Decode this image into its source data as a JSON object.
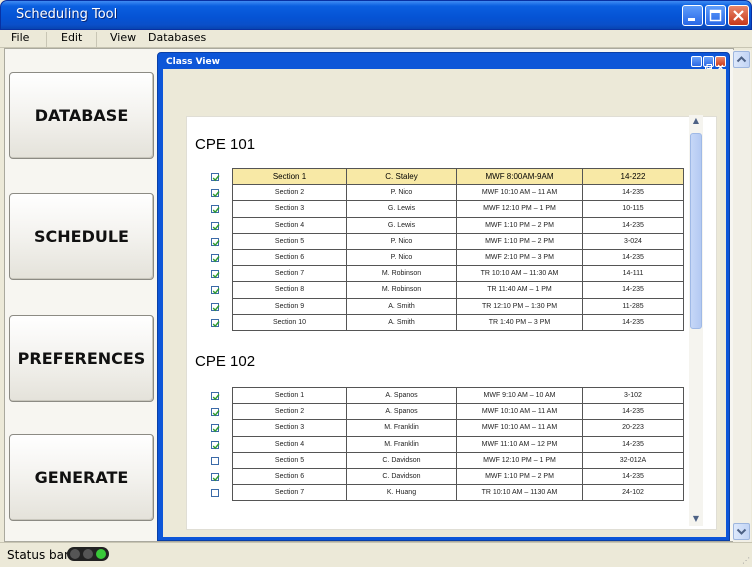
{
  "window": {
    "title": "Scheduling Tool"
  },
  "menu": {
    "items": [
      "File",
      "Edit",
      "View",
      "Databases"
    ]
  },
  "sidebar": {
    "buttons": [
      "DATABASE",
      "SCHEDULE",
      "PREFERENCES",
      "GENERATE"
    ]
  },
  "inner_window": {
    "title": "Class View"
  },
  "courses": [
    {
      "title": "CPE 101",
      "rows": [
        {
          "checked": true,
          "header": true,
          "section": "Section 1",
          "instructor": "C. Staley",
          "time": "MWF 8:00AM-9AM",
          "room": "14-222"
        },
        {
          "checked": true,
          "section": "Section 2",
          "instructor": "P. Nico",
          "time": "MWF 10:10 AM – 11 AM",
          "room": "14-235"
        },
        {
          "checked": true,
          "section": "Section 3",
          "instructor": "G. Lewis",
          "time": "MWF 12:10 PM – 1 PM",
          "room": "10-115"
        },
        {
          "checked": true,
          "section": "Section 4",
          "instructor": "G. Lewis",
          "time": "MWF 1:10 PM – 2 PM",
          "room": "14-235"
        },
        {
          "checked": true,
          "section": "Section 5",
          "instructor": "P. Nico",
          "time": "MWF 1:10 PM – 2 PM",
          "room": "3-024"
        },
        {
          "checked": true,
          "section": "Section 6",
          "instructor": "P. Nico",
          "time": "MWF 2:10 PM – 3 PM",
          "room": "14-235"
        },
        {
          "checked": true,
          "section": "Section 7",
          "instructor": "M. Robinson",
          "time": "TR 10:10 AM – 11:30 AM",
          "room": "14-111"
        },
        {
          "checked": true,
          "section": "Section 8",
          "instructor": "M. Robinson",
          "time": "TR 11:40 AM – 1 PM",
          "room": "14-235"
        },
        {
          "checked": true,
          "section": "Section 9",
          "instructor": "A. Smith",
          "time": "TR 12:10 PM – 1:30 PM",
          "room": "11-285"
        },
        {
          "checked": true,
          "section": "Section 10",
          "instructor": "A. Smith",
          "time": "TR 1:40 PM – 3 PM",
          "room": "14-235"
        }
      ]
    },
    {
      "title": "CPE 102",
      "rows": [
        {
          "checked": true,
          "section": "Section 1",
          "instructor": "A. Spanos",
          "time": "MWF 9:10 AM – 10 AM",
          "room": "3-102"
        },
        {
          "checked": true,
          "section": "Section 2",
          "instructor": "A. Spanos",
          "time": "MWF 10:10 AM – 11 AM",
          "room": "14-235"
        },
        {
          "checked": true,
          "section": "Section 3",
          "instructor": "M. Franklin",
          "time": "MWF 10:10 AM – 11 AM",
          "room": "20-223"
        },
        {
          "checked": true,
          "section": "Section 4",
          "instructor": "M. Franklin",
          "time": "MWF 11:10 AM – 12 PM",
          "room": "14-235"
        },
        {
          "checked": false,
          "section": "Section 5",
          "instructor": "C. Davidson",
          "time": "MWF 12:10 PM – 1 PM",
          "room": "32-012A"
        },
        {
          "checked": true,
          "section": "Section 6",
          "instructor": "C. Davidson",
          "time": "MWF 1:10 PM – 2 PM",
          "room": "14-235"
        },
        {
          "checked": false,
          "section": "Section 7",
          "instructor": "K. Huang",
          "time": "TR 10:10 AM – 1130 AM",
          "room": "24-102"
        }
      ]
    }
  ],
  "status": {
    "text": "Status bar",
    "light_colors": [
      "#555555",
      "#555555",
      "#39c939"
    ]
  },
  "colors": {
    "title_bar": "#0553d4",
    "header_row": "#f8e9a6",
    "checkbox_border": "#3b6aa8",
    "checkmark": "#2e9b2e"
  }
}
